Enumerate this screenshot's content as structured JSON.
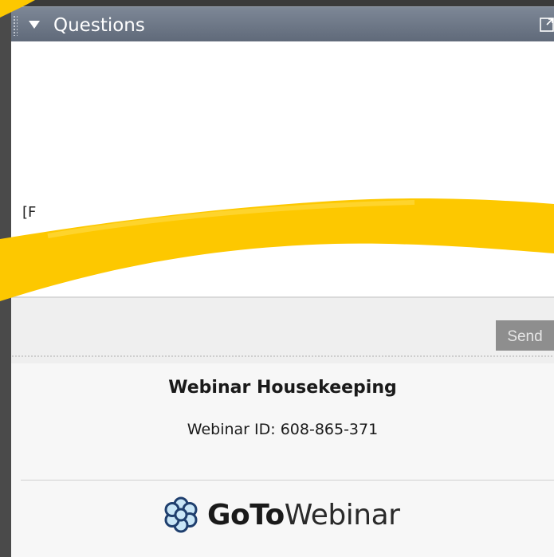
{
  "panel": {
    "header_title": "Questions",
    "send_label": "Send",
    "input_partial": "[F"
  },
  "footer": {
    "title": "Webinar Housekeeping",
    "webinar_id": "Webinar ID: 608-865-371",
    "brand_bold": "GoTo",
    "brand_light": "Webinar"
  },
  "colors": {
    "header": "#6b7584",
    "highlight": "#fdc800",
    "send_button": "#8e8e8e"
  },
  "icons": {
    "collapse": "triangle-down-icon",
    "popout": "popout-icon",
    "logo": "gotowebinar-flower-icon"
  }
}
